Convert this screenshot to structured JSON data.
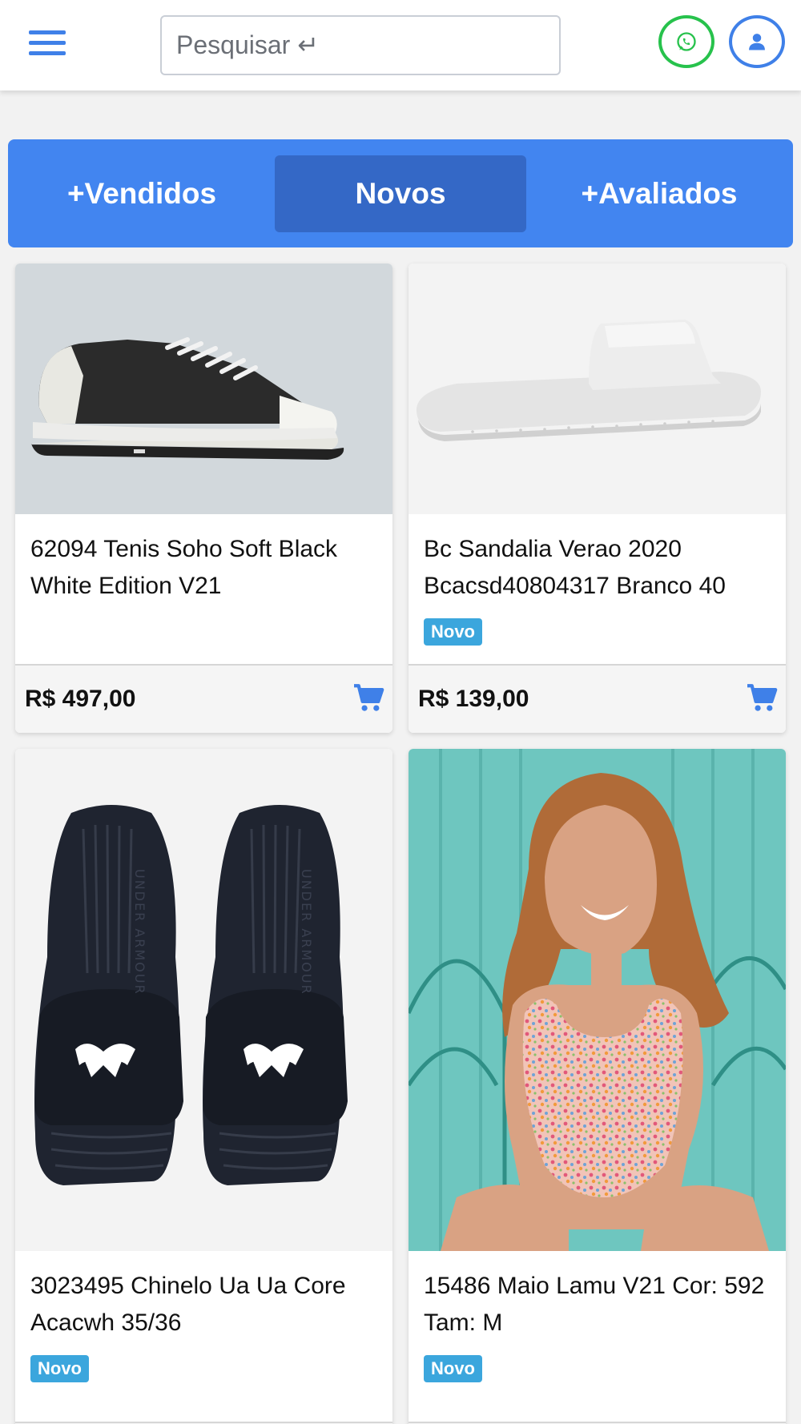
{
  "header": {
    "search_placeholder": "Pesquisar ↵",
    "icons": {
      "menu": "hamburger-icon",
      "whatsapp": "whatsapp-icon",
      "user": "user-icon"
    },
    "colors": {
      "accent": "#4285f0",
      "whatsapp": "#27c24c"
    }
  },
  "tabs": [
    {
      "label": "+Vendidos",
      "active": false
    },
    {
      "label": "Novos",
      "active": true
    },
    {
      "label": "+Avaliados",
      "active": false
    }
  ],
  "products": [
    {
      "title": "62094 Tenis Soho Soft Black White Edition V21",
      "badge": "",
      "price": "R$ 497,00",
      "image": "black-white-sneaker"
    },
    {
      "title": "Bc Sandalia Verao 2020 Bcacsd40804317 Branco 40",
      "badge": "Novo",
      "price": "R$ 139,00",
      "image": "white-slide-sandal"
    },
    {
      "title": "3023495 Chinelo Ua Ua Core Acacwh 35/36",
      "badge": "Novo",
      "price": "",
      "image": "black-under-armour-slides",
      "logo_text": "UNDER ARMOUR"
    },
    {
      "title": "15486 Maio Lamu V21 Cor: 592 Tam: M",
      "badge": "Novo",
      "price": "",
      "image": "woman-floral-swimsuit"
    }
  ]
}
